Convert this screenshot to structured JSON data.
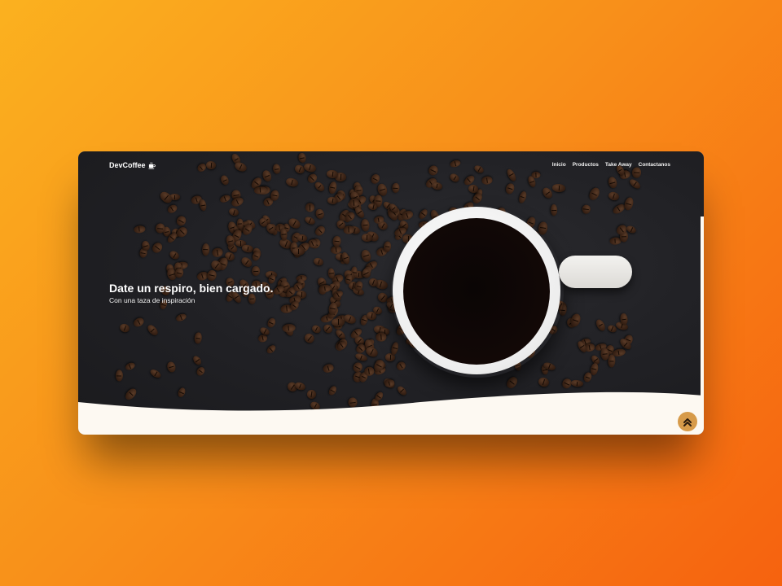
{
  "navbar": {
    "brand": "DevCoffee",
    "brand_icon": "coffee-cup-icon",
    "links": [
      "Inicio",
      "Productos",
      "Take Away",
      "Contactanos"
    ]
  },
  "hero": {
    "title": "Date un respiro, bien cargado.",
    "subtitle": "Con una taza de inspiración"
  },
  "scroll_top_icon": "double-chevron-up-icon",
  "colors": {
    "background_start": "#fbb11f",
    "background_end": "#f6620f",
    "hero_dark": "#202024",
    "wave": "#fdf9f2",
    "accent": "#d79b4a"
  }
}
